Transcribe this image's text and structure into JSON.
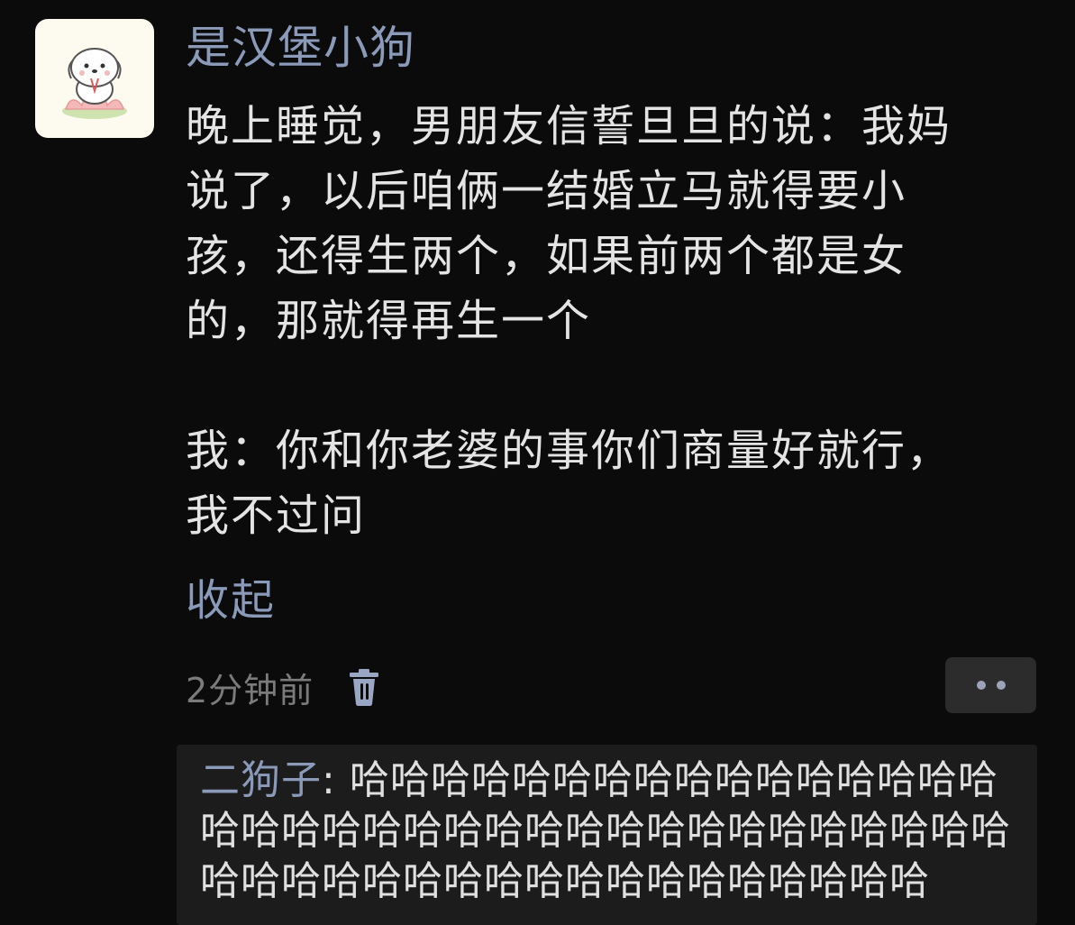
{
  "post": {
    "avatar_icon": "white-puppy-on-lotus-icon",
    "username": "是汉堡小狗",
    "body_lines": [
      "晚上睡觉，男朋友信誓旦旦的说：我妈",
      "说了，以后咱俩一结婚立马就得要小",
      "孩，还得生两个，如果前两个都是女",
      "的，那就得再生一个"
    ],
    "reply_lines": [
      "我：你和你老婆的事你们商量好就行，",
      "我不过问"
    ],
    "collapse_label": "收起",
    "timestamp": "2分钟前",
    "delete_icon": "trash-icon",
    "more_icon": "more-dots-icon"
  },
  "reply": {
    "author": "二狗子",
    "separator": ":",
    "text": "哈哈哈哈哈哈哈哈哈哈哈哈哈哈哈哈哈哈哈哈哈哈哈哈哈哈哈哈哈哈哈哈哈哈哈哈哈哈哈哈哈哈哈哈哈哈哈哈哈哈哈哈哈哈"
  },
  "colors": {
    "background": "#0b0b0b",
    "accent_link": "#8a9ab8",
    "text": "#e4e4e4",
    "muted": "#7b7b7b",
    "reply_background": "#1c1c1c"
  }
}
